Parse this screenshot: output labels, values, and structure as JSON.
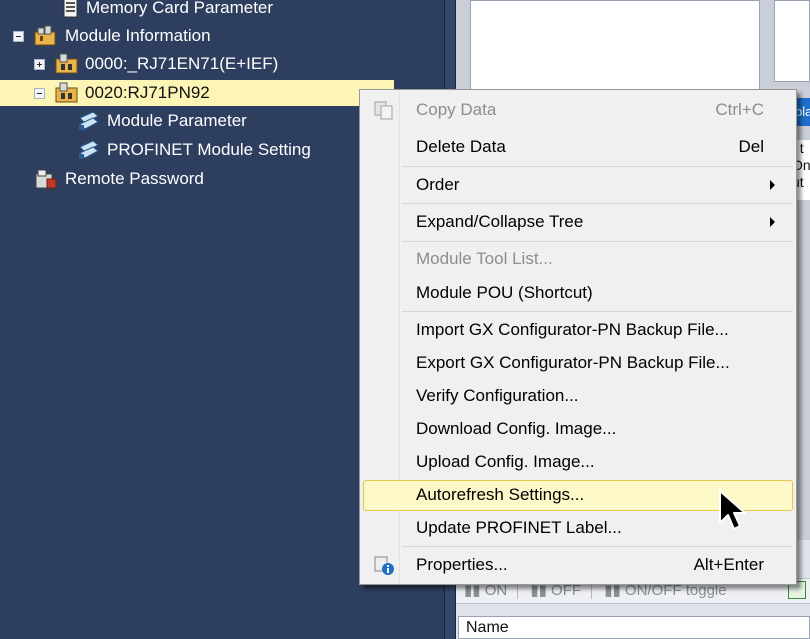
{
  "tree": {
    "items": [
      {
        "label": "Memory Card Parameter",
        "icon": "memory-card-parameter-icon"
      },
      {
        "label": "Module Information",
        "icon": "module-folder-icon"
      },
      {
        "label": "0000:_RJ71EN71(E+IEF)",
        "icon": "module-unit-icon"
      },
      {
        "label": "0020:RJ71PN92",
        "icon": "module-unit-icon"
      },
      {
        "label": "Module Parameter",
        "icon": "parameter-icon"
      },
      {
        "label": "PROFINET Module Setting",
        "icon": "parameter-icon"
      },
      {
        "label": "Remote Password",
        "icon": "remote-password-icon"
      }
    ]
  },
  "right_panel": {
    "tab_partial": "bla",
    "side_text": [
      "t t",
      "Onl",
      "ut"
    ],
    "toolbar": {
      "on": "ON",
      "off": "OFF",
      "toggle": "ON/OFF toggle"
    },
    "grid_header": "Name"
  },
  "context_menu": {
    "copy_data": {
      "label": "Copy Data",
      "shortcut": "Ctrl+C"
    },
    "delete_data": {
      "label": "Delete Data",
      "shortcut": "Del"
    },
    "order": {
      "label": "Order"
    },
    "expand_collapse": {
      "label": "Expand/Collapse Tree"
    },
    "module_tool_list": {
      "label": "Module Tool List..."
    },
    "module_pou": {
      "label": "Module POU (Shortcut)"
    },
    "import_backup": {
      "label": "Import GX Configurator-PN Backup File..."
    },
    "export_backup": {
      "label": "Export GX Configurator-PN Backup File..."
    },
    "verify_config": {
      "label": "Verify Configuration..."
    },
    "download_image": {
      "label": "Download Config. Image..."
    },
    "upload_image": {
      "label": "Upload Config. Image..."
    },
    "autorefresh": {
      "label": "Autorefresh Settings..."
    },
    "update_label": {
      "label": "Update PROFINET Label..."
    },
    "properties": {
      "label": "Properties...",
      "shortcut": "Alt+Enter"
    }
  },
  "colors": {
    "tree_background": "#2d3e5e",
    "selection": "#fcf5b5",
    "menu_highlight": "#fdf8c8",
    "menu_highlight_border": "#e6c54d",
    "disabled_text": "#8d8d8d"
  }
}
